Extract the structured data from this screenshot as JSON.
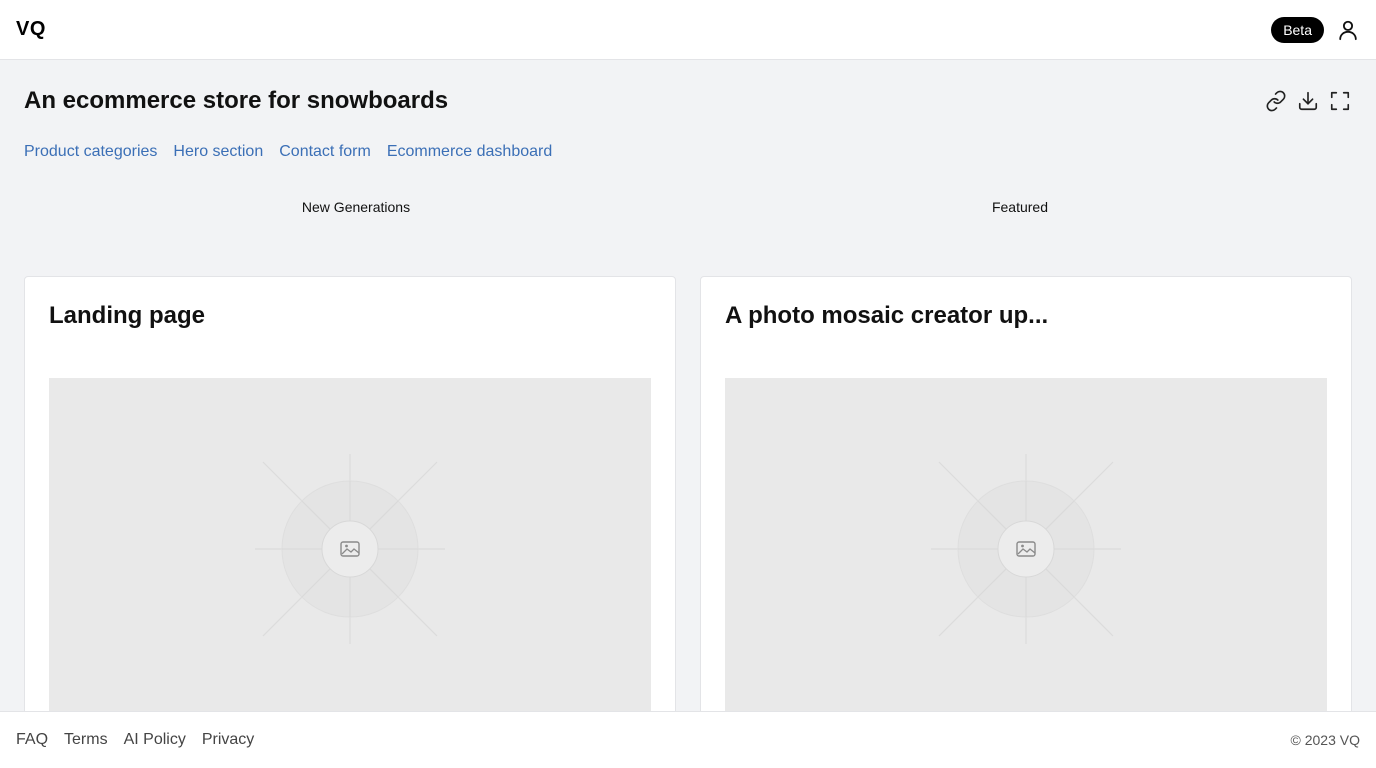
{
  "header": {
    "logo": "VQ",
    "badge": "Beta",
    "user_icon": "user-icon"
  },
  "main": {
    "title": "An ecommerce store for snowboards",
    "actions": [
      "link-icon",
      "download-icon",
      "fullscreen-icon"
    ],
    "tags": [
      "Product categories",
      "Hero section",
      "Contact form",
      "Ecommerce dashboard"
    ],
    "columns": [
      "New Generations",
      "Featured"
    ],
    "cards": [
      {
        "title": "Landing page",
        "image_icon": "image-placeholder-icon"
      },
      {
        "title": "A photo mosaic creator up...",
        "image_icon": "image-placeholder-icon"
      }
    ]
  },
  "footer": {
    "links": [
      "FAQ",
      "Terms",
      "AI Policy",
      "Privacy"
    ],
    "copyright": "© 2023 VQ"
  },
  "colors": {
    "background": "#f2f3f5",
    "link": "#3b6fb6",
    "badge": "#000000",
    "placeholder": "#e9e9e9"
  }
}
